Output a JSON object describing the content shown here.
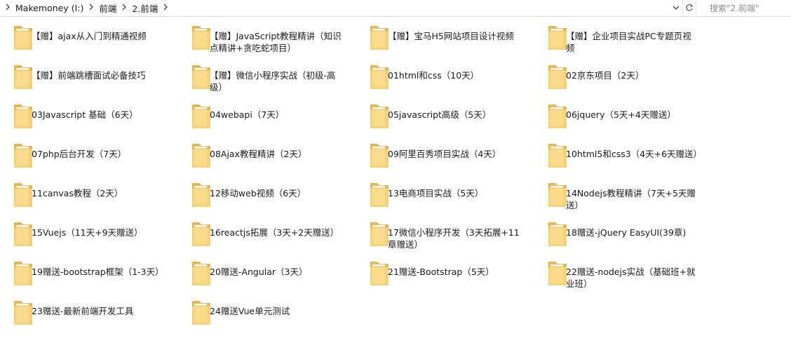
{
  "address": {
    "crumbs": [
      "Makemoney (I:)",
      "前端",
      "2.前端"
    ]
  },
  "search": {
    "placeholder": "搜索\"2.前端\""
  },
  "icons": {
    "separator": "chevron-right-icon",
    "dropdown": "chevron-down-icon",
    "refresh": "refresh-icon",
    "folder": "folder-icon"
  },
  "colors": {
    "folder_back": "#e8b64a",
    "folder_front": "#f8d67b",
    "paper": "#ffffff"
  },
  "folders": [
    {
      "label": "【赠】ajax从入门到精通视频"
    },
    {
      "label": "【赠】JavaScript教程精讲（知识点精讲+贪吃蛇项目）"
    },
    {
      "label": "【赠】宝马H5网站项目设计视频"
    },
    {
      "label": "【赠】企业项目实战PC专题页视频"
    },
    {
      "label": "【赠】前端跳槽面试必备技巧"
    },
    {
      "label": "【赠】微信小程序实战（初级-高级）"
    },
    {
      "label": "01html和css（10天）"
    },
    {
      "label": "02京东项目（2天）"
    },
    {
      "label": "03Javascript 基础（6天）"
    },
    {
      "label": "04webapi（7天）"
    },
    {
      "label": "05javascript高级（5天）"
    },
    {
      "label": "06jquery（5天+4天赠送）"
    },
    {
      "label": "07php后台开发（7天）"
    },
    {
      "label": "08Ajax教程精讲（2天）"
    },
    {
      "label": "09阿里百秀项目实战（4天）"
    },
    {
      "label": "10html5和css3（4天+6天赠送）"
    },
    {
      "label": "11canvas教程（2天）"
    },
    {
      "label": "12移动web视频（6天）"
    },
    {
      "label": "13电商项目实战（5天）"
    },
    {
      "label": "14Nodejs教程精讲（7天+5天赠送）"
    },
    {
      "label": "15Vuejs（11天+9天赠送）"
    },
    {
      "label": "16reactjs拓展（3天+2天赠送）"
    },
    {
      "label": "17微信小程序开发（3天拓展+11章赠送）"
    },
    {
      "label": "18赠送-jQuery EasyUI(39章)"
    },
    {
      "label": "19赠送-bootstrap框架（1-3天）"
    },
    {
      "label": "20赠送-Angular（3天）"
    },
    {
      "label": "21赠送-Bootstrap（5天）"
    },
    {
      "label": "22赠送-nodejs实战（基础班+就业班）"
    },
    {
      "label": "23赠送-最新前端开发工具"
    },
    {
      "label": "24赠送Vue单元测试"
    }
  ]
}
